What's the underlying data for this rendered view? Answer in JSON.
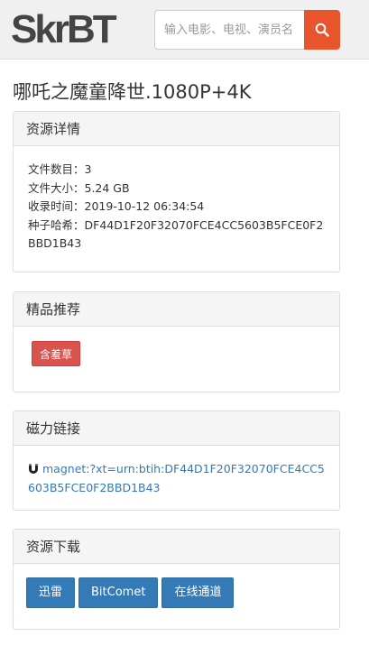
{
  "header": {
    "logo_text": "SkrBT",
    "search_placeholder": "输入电影、电视、演员名",
    "search_button_icon": "search-icon",
    "accent_color": "#e8542c"
  },
  "page_title": "哪吒之魔童降世.1080P+4K",
  "details": {
    "heading": "资源详情",
    "file_count": "文件数目：3",
    "file_size": "文件大小：5.24 GB",
    "indexed_time": "收录时间：2019-10-12 06:34:54",
    "hash": "种子哈希：DF44D1F20F32070FCE4CC5603B5FCE0F2BBD1B43"
  },
  "recommend": {
    "heading": "精品推荐",
    "tag_label": "含羞草"
  },
  "magnet": {
    "heading": "磁力链接",
    "icon": "magnet-icon",
    "link": "magnet:?xt=urn:btih:DF44D1F20F32070FCE4CC5603B5FCE0F2BBD1B43"
  },
  "download": {
    "heading": "资源下载",
    "buttons": [
      "迅雷",
      "BitComet",
      "在线通道"
    ]
  }
}
